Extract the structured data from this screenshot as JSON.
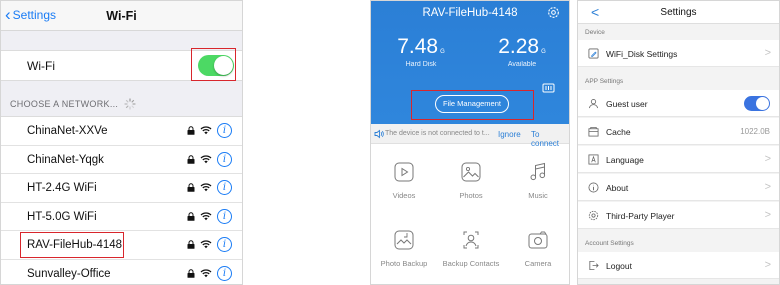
{
  "wifi": {
    "back_label": "Settings",
    "title": "Wi-Fi",
    "toggle_label": "Wi-Fi",
    "toggle_on": true,
    "choose_label": "CHOOSE A NETWORK...",
    "networks": [
      {
        "name": "ChinaNet-XXVe"
      },
      {
        "name": "ChinaNet-Yqgk"
      },
      {
        "name": "HT-2.4G WiFi"
      },
      {
        "name": "HT-5.0G WiFi"
      },
      {
        "name": "RAV-FileHub-4148"
      },
      {
        "name": "Sunvalley-Office"
      }
    ],
    "info_glyph": "i",
    "colors": {
      "accent": "#1a7cf5",
      "switch_on": "#4cd964",
      "highlight": "#d8262c"
    }
  },
  "hub": {
    "title": "RAV-FileHub-4148",
    "hard_disk": {
      "value": "7.48",
      "unit": "G",
      "caption": "Hard Disk"
    },
    "available": {
      "value": "2.28",
      "unit": "G",
      "caption": "Available"
    },
    "file_management_label": "File Management",
    "notice": {
      "message": "The device is not connected to t...",
      "ignore_label": "Ignore",
      "connect_label": "To connect"
    },
    "tiles": [
      {
        "label": "Videos",
        "icon": "video-icon"
      },
      {
        "label": "Photos",
        "icon": "photos-icon"
      },
      {
        "label": "Music",
        "icon": "music-icon"
      },
      {
        "label": "Photo Backup",
        "icon": "photo-backup-icon"
      },
      {
        "label": "Backup Contacts",
        "icon": "backup-contacts-icon"
      },
      {
        "label": "Camera",
        "icon": "camera-icon"
      }
    ],
    "colors": {
      "brand": "#2b7fd6"
    }
  },
  "settings": {
    "back_glyph": "<",
    "title": "Settings",
    "section_device": "Device",
    "wifi_disk_label": "WiFi_Disk Settings",
    "section_app": "APP Settings",
    "guest_label": "Guest user",
    "guest_on": true,
    "cache_label": "Cache",
    "cache_value": "1022.0B",
    "language_label": "Language",
    "about_label": "About",
    "third_party_label": "Third-Party Player",
    "section_account": "Account Settings",
    "logout_label": "Logout",
    "arrow_glyph": ">",
    "colors": {
      "switch_on": "#3a73e0"
    }
  }
}
